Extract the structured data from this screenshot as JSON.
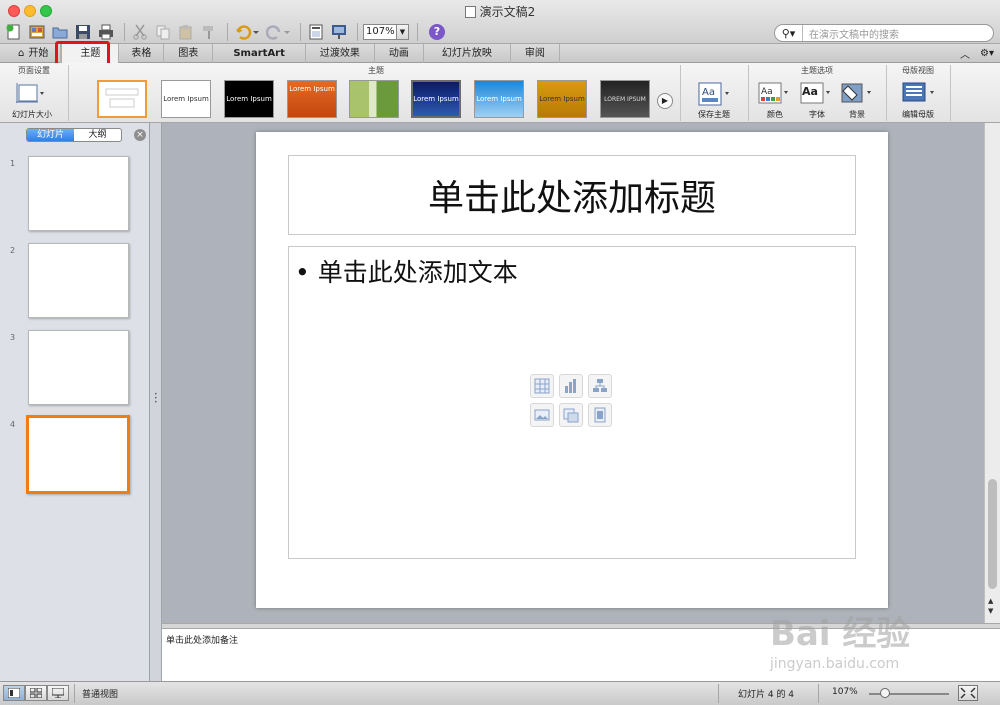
{
  "window": {
    "title": "演示文稿2"
  },
  "toolbar": {
    "zoom_value": "107%",
    "help_label": "?"
  },
  "search": {
    "placeholder": "在演示文稿中的搜索"
  },
  "ribbon_tabs": [
    "开始",
    "主题",
    "表格",
    "图表",
    "SmartArt",
    "过渡效果",
    "动画",
    "幻灯片放映",
    "审阅"
  ],
  "ribbon_active_tab": "主题",
  "ribbon": {
    "page_setup_group": "页面设置",
    "slide_size_label": "幻灯片大小",
    "themes_group": "主题",
    "themes": [
      "",
      "Lorem Ipsum",
      "Lorem Ipsum",
      "Lorem Ipsum",
      "",
      "Lorem Ipsum",
      "Lorem Ipsum",
      "Lorem Ipsum",
      "LOREM IPSUM"
    ],
    "save_theme_label": "保存主题",
    "theme_options_group": "主题选项",
    "colors_label": "颜色",
    "fonts_label": "字体",
    "background_label": "背景",
    "master_view_group": "母版视图",
    "edit_master_label": "编辑母版"
  },
  "left_pane": {
    "slides_tab": "幻灯片",
    "outline_tab": "大纲",
    "slide_numbers": [
      "1",
      "2",
      "3",
      "4"
    ]
  },
  "slide": {
    "title_placeholder": "单击此处添加标题",
    "body_placeholder": "单击此处添加文本"
  },
  "notes": {
    "placeholder": "单击此处添加备注"
  },
  "status_bar": {
    "view_name": "普通视图",
    "slide_position": "幻灯片 4 的 4",
    "zoom": "107%",
    "zoom_level_fraction": 0.2
  },
  "watermark": {
    "brand": "Bai 经验",
    "url": "jingyan.baidu.com"
  },
  "colors": {
    "accent_red": "#e0141c",
    "selected_orange": "#f07c14",
    "active_blue": "#2f80e8"
  }
}
